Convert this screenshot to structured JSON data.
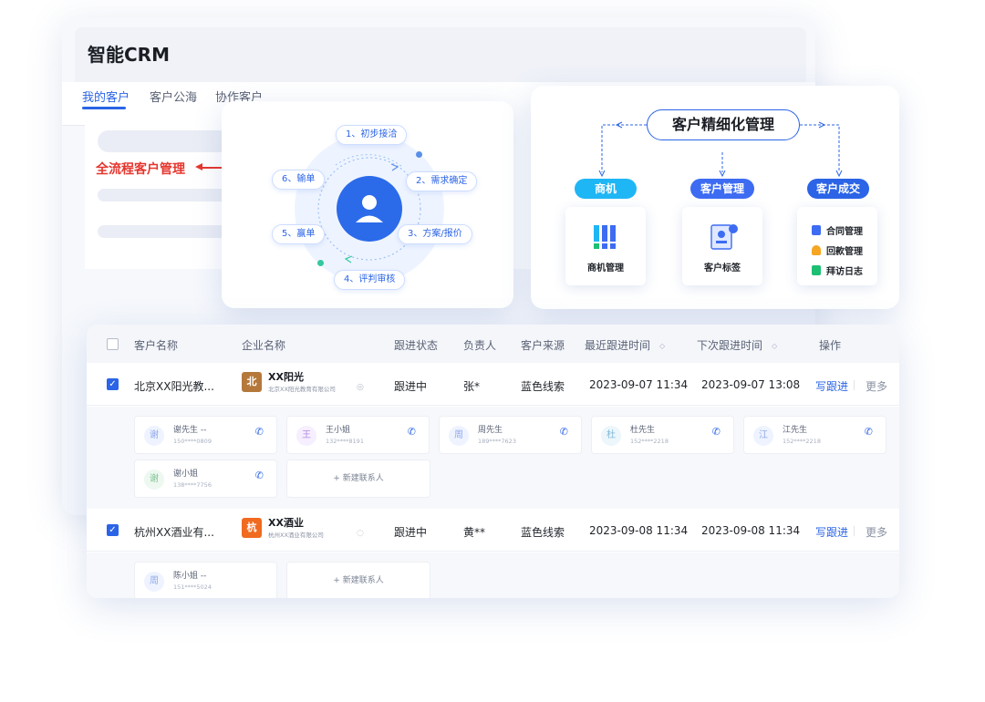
{
  "app": {
    "title": "智能CRM"
  },
  "tabs": [
    {
      "label": "我的客户",
      "active": true
    },
    {
      "label": "客户公海",
      "active": false
    },
    {
      "label": "协作客户",
      "active": false
    }
  ],
  "feature_label": "全流程客户管理",
  "cycle": {
    "steps": [
      "1、初步接洽",
      "2、需求确定",
      "3、方案/报价",
      "4、评判审核",
      "5、赢单",
      "6、输单"
    ]
  },
  "management": {
    "title": "客户精细化管理",
    "categories": [
      {
        "label": "商机",
        "color": "#1fb6f5",
        "item": "商机管理",
        "icon": "bar-chart-icon"
      },
      {
        "label": "客户管理",
        "color": "#3d6cf2",
        "item": "客户标签",
        "icon": "contact-card-icon"
      },
      {
        "label": "客户成交",
        "color": "#2b64e6",
        "items": [
          {
            "label": "合同管理",
            "icon": "contract-icon",
            "color": "#3d6cf2"
          },
          {
            "label": "回款管理",
            "icon": "money-bag-icon",
            "color": "#f5a623"
          },
          {
            "label": "拜访日志",
            "icon": "log-icon",
            "color": "#1dbf73"
          }
        ]
      }
    ]
  },
  "table": {
    "headers": [
      "客户名称",
      "企业名称",
      "跟进状态",
      "负责人",
      "客户来源",
      "最近跟进时间",
      "下次跟进时间",
      "操作"
    ],
    "rows": [
      {
        "customer": "北京XX阳光教...",
        "company_logo_char": "北",
        "company_logo_color": "#b5783b",
        "company": "XX阳光",
        "company_full": "北京XX阳光教育有限公司",
        "status": "跟进中",
        "owner": "张*",
        "source": "蓝色线索",
        "last": "2023-09-07 11:34",
        "next": "2023-09-07 13:08",
        "action": "写跟进",
        "more": "更多",
        "contacts": [
          {
            "initial": "谢",
            "name": "谢先生 --",
            "phone": "150****0809",
            "color": "#8fa9e8",
            "bg": "#eef3ff"
          },
          {
            "initial": "王",
            "name": "王小姐",
            "phone": "132****8191",
            "color": "#b48be0",
            "bg": "#f6efff"
          },
          {
            "initial": "周",
            "name": "周先生",
            "phone": "189****7623",
            "color": "#8fa9e8",
            "bg": "#eef3ff"
          },
          {
            "initial": "杜",
            "name": "杜先生",
            "phone": "152****2218",
            "color": "#7fb8d8",
            "bg": "#ecf6fb"
          },
          {
            "initial": "江",
            "name": "江先生",
            "phone": "152****2218",
            "color": "#8fa9e8",
            "bg": "#eef3ff"
          },
          {
            "initial": "谢",
            "name": "谢小姐",
            "phone": "138****7756",
            "color": "#83c296",
            "bg": "#edf8f0"
          }
        ]
      },
      {
        "customer": "杭州XX酒业有...",
        "company_logo_char": "杭",
        "company_logo_color": "#f06a1f",
        "company": "XX酒业",
        "company_full": "杭州XX酒业有限公司",
        "status": "跟进中",
        "owner": "黄**",
        "source": "蓝色线索",
        "last": "2023-09-08 11:34",
        "next": "2023-09-08 11:34",
        "action": "写跟进",
        "more": "更多",
        "contacts": [
          {
            "initial": "周",
            "name": "陈小姐 --",
            "phone": "151****5024",
            "color": "#8fa9e8",
            "bg": "#eef3ff"
          }
        ]
      }
    ],
    "add_contact_label": "+ 新建联系人"
  }
}
